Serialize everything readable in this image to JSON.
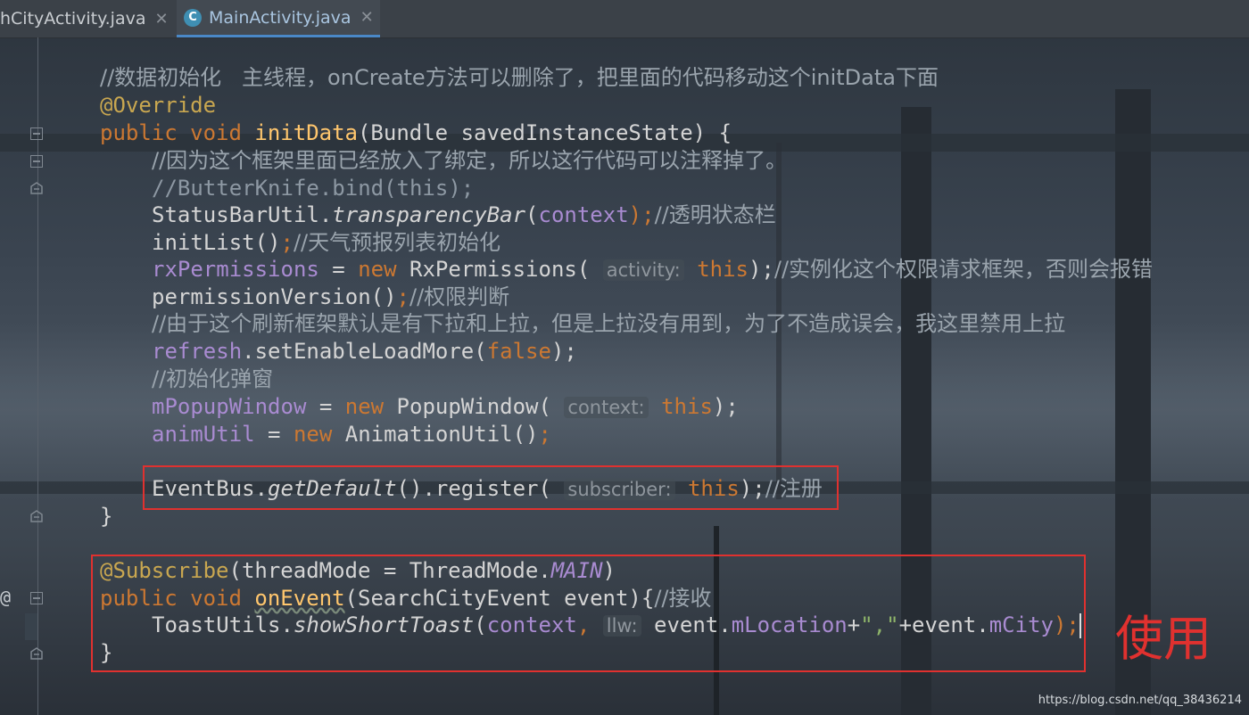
{
  "tabs": [
    {
      "label": "hCityActivity.java",
      "close": "✕"
    },
    {
      "label": "MainActivity.java",
      "icon_text": "C",
      "close": "✕"
    }
  ],
  "gutter": {
    "at_marker": "@"
  },
  "code_lines": {
    "l01": "//数据初始化   主线程，onCreate方法可以删除了，把里面的代码移动这个initData下面",
    "l02": "@Override",
    "l03_kw": "public void ",
    "l03_fn": "initData",
    "l03_rest": "(Bundle savedInstanceState) {",
    "l04": "//因为这个框架里面已经放入了绑定，所以这行代码可以注释掉了。",
    "l05": "//ButterKnife.bind(this);",
    "l06_a": "StatusBarUtil.",
    "l06_b": "transparencyBar",
    "l06_c": "(",
    "l06_d": "context",
    "l06_e": ");",
    "l06_f": "//透明状态栏",
    "l07_a": "initList()",
    "l07_b": ";",
    "l07_c": "//天气预报列表初始化",
    "l08_a": "rxPermissions",
    "l08_b": " = ",
    "l08_c": "new",
    "l08_d": " RxPermissions(",
    "l08_hint": "activity:",
    "l08_e": "this",
    "l08_f": ");",
    "l08_g": "//实例化这个权限请求框架，否则会报错",
    "l09_a": "permissionVersion()",
    "l09_b": ";",
    "l09_c": "//权限判断",
    "l10": "//由于这个刷新框架默认是有下拉和上拉，但是上拉没有用到，为了不造成误会，我这里禁用上拉",
    "l11_a": "refresh",
    "l11_b": ".setEnableLoadMore(",
    "l11_c": "false",
    "l11_d": ");",
    "l12": "//初始化弹窗",
    "l13_a": "mPopupWindow",
    "l13_b": " = ",
    "l13_c": "new",
    "l13_d": " PopupWindow(",
    "l13_hint": "context:",
    "l13_e": "this",
    "l13_f": ");",
    "l14_a": "animUtil",
    "l14_b": " = ",
    "l14_c": "new",
    "l14_d": " AnimationUtil()",
    "l14_e": ";",
    "l15_a": "EventBus.",
    "l15_b": "getDefault",
    "l15_c": "().register(",
    "l15_hint": "subscriber:",
    "l15_d": "this",
    "l15_e": ");",
    "l15_f": "//注册",
    "l16": "}",
    "l17_a": "@Subscribe",
    "l17_b": "(threadMode = ThreadMode.",
    "l17_c": "MAIN",
    "l17_d": ")",
    "l18_kw": "public void ",
    "l18_fn": "onEvent",
    "l18_rest": "(SearchCityEvent event){",
    "l18_cm": "//接收",
    "l19_a": "ToastUtils.",
    "l19_b": "showShortToast",
    "l19_c": "(",
    "l19_d": "context",
    "l19_e": ", ",
    "l19_hint": "llw:",
    "l19_f": " event.",
    "l19_g": "mLocation",
    "l19_h": "+",
    "l19_i": "\",\"",
    "l19_j": "+event.",
    "l19_k": "mCity",
    "l19_l": ");",
    "l20": "}"
  },
  "annotation_label": "使用",
  "watermark": "https://blog.csdn.net/qq_38436214",
  "colors": {
    "keyword": "#cc7832",
    "function": "#ffc66d",
    "field": "#a98bd1",
    "annotation": "#c9a750",
    "comment": "#8d98a3",
    "highlight_box": "#e0312f"
  }
}
